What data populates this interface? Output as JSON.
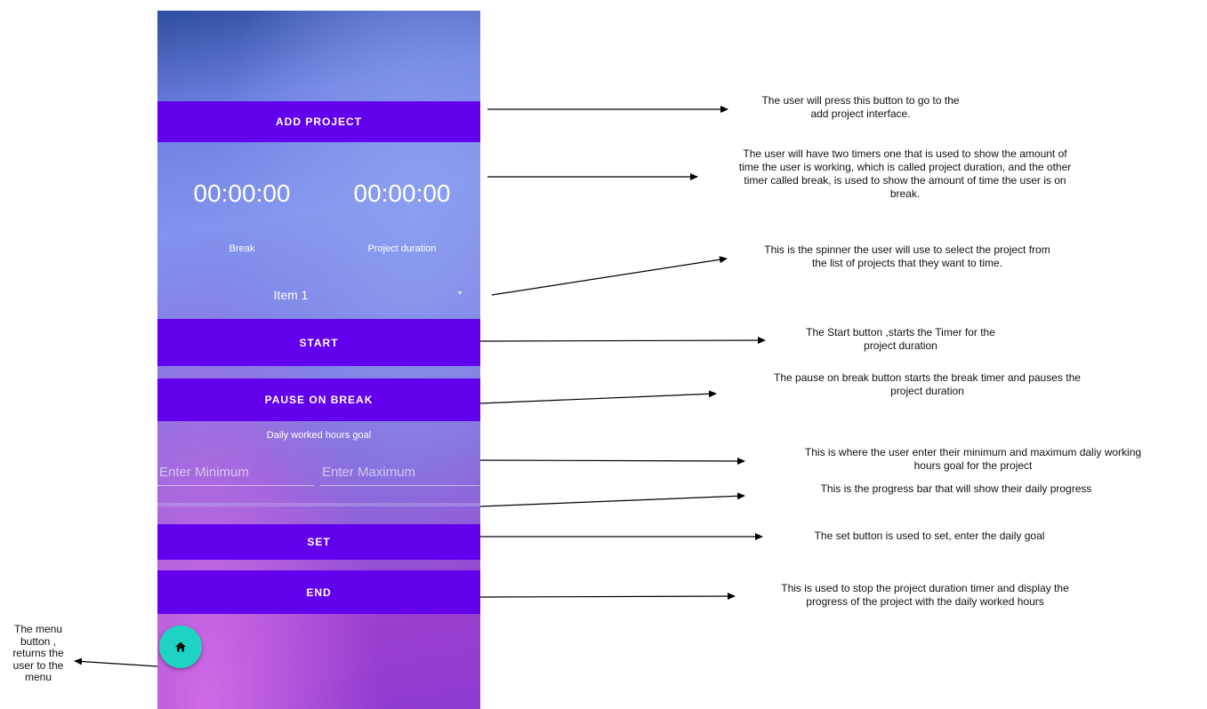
{
  "app": {
    "buttons": {
      "add_project": "ADD PROJECT",
      "start": "START",
      "pause_on_break": "PAUSE ON BREAK",
      "set": "SET",
      "end": "END"
    },
    "timers": {
      "break_time": "00:00:00",
      "break_label": "Break",
      "project_time": "00:00:00",
      "project_label": "Project duration"
    },
    "spinner": {
      "selected": "Item 1"
    },
    "goal": {
      "label": "Daily worked hours goal",
      "min_placeholder": "Enter Minimum",
      "max_placeholder": "Enter Maximum"
    },
    "progress": {
      "value_percent": 0
    },
    "fab": {
      "icon": "home-icon"
    },
    "colors": {
      "button": "#6200ee",
      "fab": "#1fd3c3"
    }
  },
  "annotations": {
    "add_project": "The user will press this button to go to the\nadd project interface.",
    "timers": "The user will have two timers one that is used  to show the amount of\ntime the user is working, which is called project duration, and the other\ntimer called break, is used to show the amount of time the user is on\nbreak.",
    "spinner": "This is the spinner the user will use to select the project from\nthe list of projects that they want to time.",
    "start": "The Start button ,starts the Timer for the\nproject duration",
    "pause": "The pause on break button starts the break timer and pauses the\nproject duration",
    "goal_inputs": "This is where the user enter their minimum and maximum daliy working\nhours goal for the project",
    "progress": "This is the progress bar that will show their daily progress",
    "set": "The set button is used to set, enter the daily goal",
    "end": "This is used to stop the project duration timer and display the\nprogress of the project with the daily worked hours",
    "menu": "The menu\nbutton ,\nreturns the\nuser to the\nmenu"
  }
}
